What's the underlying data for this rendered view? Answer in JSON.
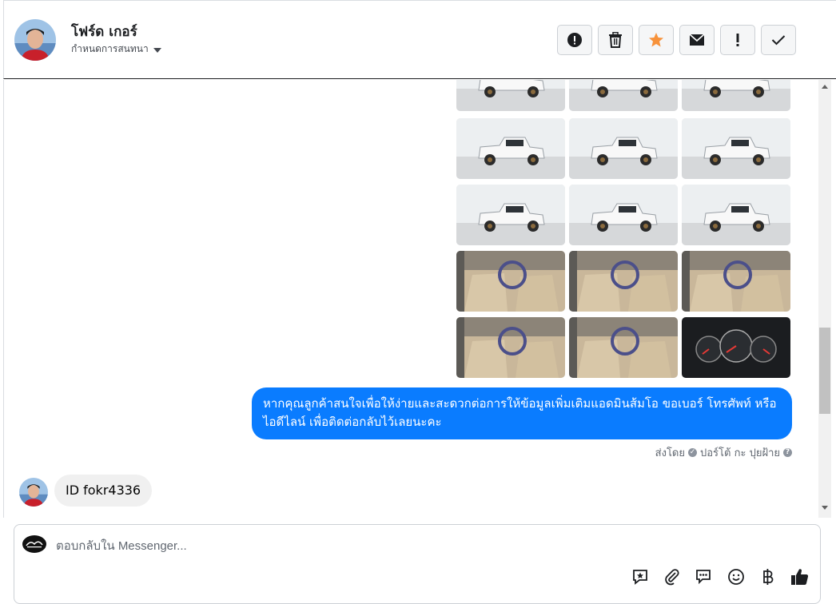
{
  "header": {
    "contact_name": "โฟร์ด เกอร์",
    "assign_label": "กำหนดการสนทนา",
    "actions": [
      {
        "name": "report-spam-button",
        "icon": "alert-circle-icon"
      },
      {
        "name": "delete-button",
        "icon": "trash-icon"
      },
      {
        "name": "star-button",
        "icon": "star-icon"
      },
      {
        "name": "mark-unread-button",
        "icon": "envelope-icon"
      },
      {
        "name": "follow-up-button",
        "icon": "exclamation-icon"
      },
      {
        "name": "mark-done-button",
        "icon": "checkmark-icon"
      }
    ]
  },
  "thread": {
    "outgoing_message": "หากคุณลูกค้าสนใจเพื่อให้ง่ายและสะดวกต่อการให้ข้อมูลเพิ่มเติมแอดมินส้มโอ ขอเบอร์ โทรศัพท์ หรือ ไอดีไลน์ เพื่อติดต่อกลับไว้เลยนะคะ",
    "sent_by_label": "ส่งโดย",
    "sender_name": "ปอร์โต้ กะ ปุยฝ้าย",
    "incoming_message": "ID fokr4336"
  },
  "composer": {
    "placeholder": "ตอบกลับใน Messenger...",
    "tools": [
      "saved-reply-icon",
      "paperclip-icon",
      "chat-bubbles-icon",
      "emoji-icon",
      "baht-icon",
      "thumbs-up-icon"
    ]
  },
  "colors": {
    "accent": "#0a7cff",
    "star": "#f7923b",
    "incoming_bubble": "#f0f0f0"
  }
}
